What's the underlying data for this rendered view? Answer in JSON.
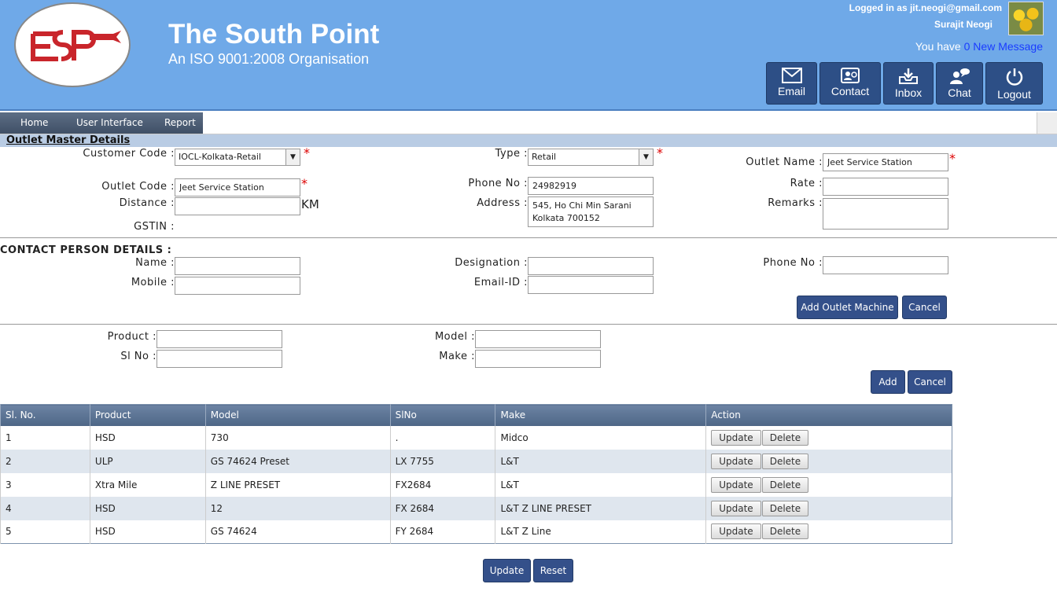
{
  "header": {
    "title": "The South Point",
    "subtitle": "An ISO 9001:2008 Organisation",
    "logged_in": "Logged in as jit.neogi@gmail.com",
    "user_name": "Surajit Neogi",
    "msg_prefix": "You have ",
    "msg_count": "0",
    "msg_suffix": " New Message",
    "buttons": [
      {
        "label": "Email",
        "icon": "envelope-icon"
      },
      {
        "label": "Contact",
        "icon": "contact-card-icon"
      },
      {
        "label": "Inbox",
        "icon": "inbox-tray-icon"
      },
      {
        "label": "Chat",
        "icon": "chat-user-icon"
      },
      {
        "label": "Logout",
        "icon": "power-icon"
      }
    ]
  },
  "menu": {
    "items": [
      "Home",
      "User Interface",
      "Report"
    ]
  },
  "section": {
    "title": "Outlet Master Details"
  },
  "form": {
    "customer_code": {
      "label": "Customer Code :",
      "value": "IOCL-Kolkata-Retail"
    },
    "type": {
      "label": "Type :",
      "value": "Retail"
    },
    "outlet_name": {
      "label": "Outlet Name :",
      "value": "Jeet Service Station"
    },
    "outlet_code": {
      "label": "Outlet Code :",
      "value": "Jeet Service Station"
    },
    "phone_no": {
      "label": "Phone No :",
      "value": "24982919"
    },
    "rate": {
      "label": "Rate :",
      "value": ""
    },
    "distance": {
      "label": "Distance :",
      "value": "",
      "unit": "KM"
    },
    "address": {
      "label": "Address :",
      "value": "545, Ho Chi Min Sarani\nKolkata 700152"
    },
    "remarks": {
      "label": "Remarks :",
      "value": ""
    },
    "gstin": {
      "label": "GSTIN :"
    },
    "required_mark": "*"
  },
  "contact": {
    "title": "CONTACT PERSON DETAILS :",
    "name": {
      "label": "Name :",
      "value": ""
    },
    "designation": {
      "label": "Designation :",
      "value": ""
    },
    "phone_no": {
      "label": "Phone No :",
      "value": ""
    },
    "mobile": {
      "label": "Mobile :",
      "value": ""
    },
    "email": {
      "label": "Email-ID :",
      "value": ""
    },
    "add_outlet_machine": "Add Outlet Machine",
    "cancel": "Cancel"
  },
  "machine": {
    "product": {
      "label": "Product :",
      "value": ""
    },
    "model": {
      "label": "Model :",
      "value": ""
    },
    "sl_no": {
      "label": "Sl No :",
      "value": ""
    },
    "make": {
      "label": "Make :",
      "value": ""
    },
    "add": "Add",
    "cancel": "Cancel"
  },
  "grid": {
    "columns": [
      "Sl. No.",
      "Product",
      "Model",
      "SlNo",
      "Make",
      "Action"
    ],
    "rows": [
      [
        "1",
        "HSD",
        "730",
        ".",
        "Midco"
      ],
      [
        "2",
        "ULP",
        "GS 74624 Preset",
        "LX 7755",
        "L&T"
      ],
      [
        "3",
        "Xtra Mile",
        "Z LINE PRESET",
        "FX2684",
        "L&T"
      ],
      [
        "4",
        "HSD",
        "12",
        "FX 2684",
        "L&T Z LINE PRESET"
      ],
      [
        "5",
        "HSD",
        "GS 74624",
        "FY 2684",
        "L&T Z Line"
      ]
    ],
    "update_label": "Update",
    "delete_label": "Delete"
  },
  "footer": {
    "update": "Update",
    "reset": "Reset"
  },
  "colors": {
    "header_bg": "#6fa9e8",
    "button_bg": "#34508a",
    "required": "#dd0000",
    "grid_header": "#5a7292"
  }
}
